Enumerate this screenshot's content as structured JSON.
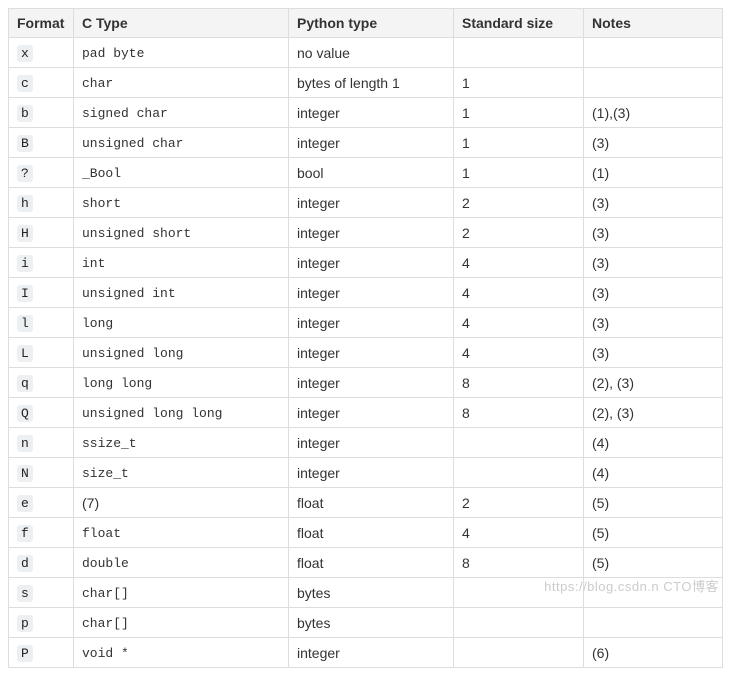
{
  "headers": {
    "format": "Format",
    "ctype": "C Type",
    "ptype": "Python type",
    "ssize": "Standard size",
    "notes": "Notes"
  },
  "rows": [
    {
      "format": "x",
      "ctype": "pad byte",
      "ctype_mono": true,
      "ptype": "no value",
      "ssize": "",
      "notes": ""
    },
    {
      "format": "c",
      "ctype": "char",
      "ctype_mono": true,
      "ptype": "bytes of length 1",
      "ssize": "1",
      "notes": ""
    },
    {
      "format": "b",
      "ctype": "signed char",
      "ctype_mono": true,
      "ptype": "integer",
      "ssize": "1",
      "notes": "(1),(3)"
    },
    {
      "format": "B",
      "ctype": "unsigned char",
      "ctype_mono": true,
      "ptype": "integer",
      "ssize": "1",
      "notes": "(3)"
    },
    {
      "format": "?",
      "ctype": "_Bool",
      "ctype_mono": true,
      "ptype": "bool",
      "ssize": "1",
      "notes": "(1)"
    },
    {
      "format": "h",
      "ctype": "short",
      "ctype_mono": true,
      "ptype": "integer",
      "ssize": "2",
      "notes": "(3)"
    },
    {
      "format": "H",
      "ctype": "unsigned short",
      "ctype_mono": true,
      "ptype": "integer",
      "ssize": "2",
      "notes": "(3)"
    },
    {
      "format": "i",
      "ctype": "int",
      "ctype_mono": true,
      "ptype": "integer",
      "ssize": "4",
      "notes": "(3)"
    },
    {
      "format": "I",
      "ctype": "unsigned int",
      "ctype_mono": true,
      "ptype": "integer",
      "ssize": "4",
      "notes": "(3)"
    },
    {
      "format": "l",
      "ctype": "long",
      "ctype_mono": true,
      "ptype": "integer",
      "ssize": "4",
      "notes": "(3)"
    },
    {
      "format": "L",
      "ctype": "unsigned long",
      "ctype_mono": true,
      "ptype": "integer",
      "ssize": "4",
      "notes": "(3)"
    },
    {
      "format": "q",
      "ctype": "long long",
      "ctype_mono": true,
      "ptype": "integer",
      "ssize": "8",
      "notes": "(2), (3)"
    },
    {
      "format": "Q",
      "ctype": "unsigned long long",
      "ctype_mono": true,
      "ptype": "integer",
      "ssize": "8",
      "notes": "(2), (3)"
    },
    {
      "format": "n",
      "ctype": "ssize_t",
      "ctype_mono": true,
      "ptype": "integer",
      "ssize": "",
      "notes": "(4)"
    },
    {
      "format": "N",
      "ctype": "size_t",
      "ctype_mono": true,
      "ptype": "integer",
      "ssize": "",
      "notes": "(4)"
    },
    {
      "format": "e",
      "ctype": "(7)",
      "ctype_mono": false,
      "ptype": "float",
      "ssize": "2",
      "notes": "(5)"
    },
    {
      "format": "f",
      "ctype": "float",
      "ctype_mono": true,
      "ptype": "float",
      "ssize": "4",
      "notes": "(5)"
    },
    {
      "format": "d",
      "ctype": "double",
      "ctype_mono": true,
      "ptype": "float",
      "ssize": "8",
      "notes": "(5)"
    },
    {
      "format": "s",
      "ctype": "char[]",
      "ctype_mono": true,
      "ptype": "bytes",
      "ssize": "",
      "notes": ""
    },
    {
      "format": "p",
      "ctype": "char[]",
      "ctype_mono": true,
      "ptype": "bytes",
      "ssize": "",
      "notes": ""
    },
    {
      "format": "P",
      "ctype": "void *",
      "ctype_mono": true,
      "ptype": "integer",
      "ssize": "",
      "notes": "(6)"
    }
  ],
  "watermark": "https://blog.csdn.n    CTO博客"
}
